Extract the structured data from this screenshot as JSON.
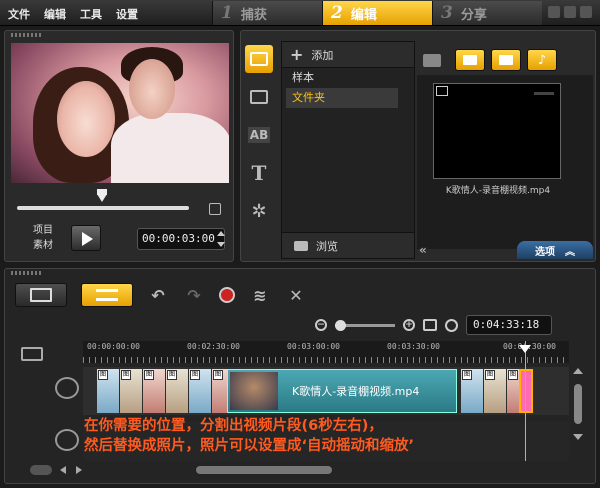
{
  "menu": [
    "文件",
    "编辑",
    "工具",
    "设置"
  ],
  "steps": [
    {
      "num": "1",
      "label": "捕获",
      "active": false
    },
    {
      "num": "2",
      "label": "编辑",
      "active": true
    },
    {
      "num": "3",
      "label": "分享",
      "active": false
    }
  ],
  "preview": {
    "mode_project": "项目",
    "mode_clip": "素材",
    "timecode": "00:00:03:00"
  },
  "library": {
    "add_label": "添加",
    "folders": [
      "样本",
      "文件夹"
    ],
    "selected_folder": "文件夹",
    "browse_label": "浏览",
    "thumb_caption": "K歌情人-录音棚视频.mp4",
    "options_label": "选项"
  },
  "timeline": {
    "timecode": "0:04:33:18",
    "ruler": [
      "00:00:00:00",
      "00:02:30:00",
      "00:03:00:00",
      "00:03:30:00",
      "00:04:30:00"
    ],
    "main_clip_title": "K歌情人-录音棚视频.mp4",
    "clip_badge": "图"
  },
  "caption": {
    "line1": "在你需要的位置，分割出视频片段(6秒左右)，",
    "line2": "然后替换成照片，照片可以设置成‘自动摇动和缩放’"
  },
  "colors": {
    "accent": "#ffc20e",
    "caption": "#ff5a1f",
    "options": "#2c5a87"
  }
}
